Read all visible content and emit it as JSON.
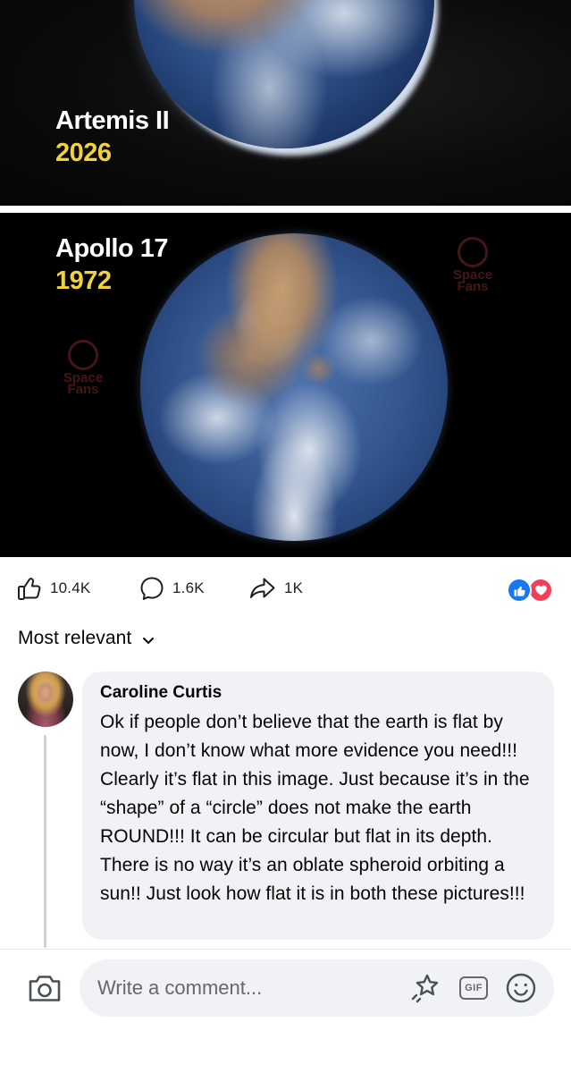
{
  "post": {
    "top_image": {
      "title": "Artemis II",
      "year": "2026"
    },
    "bottom_image": {
      "title": "Apollo 17",
      "year": "1972"
    },
    "watermark": {
      "line1": "Space",
      "line2": "Fans"
    }
  },
  "actions": {
    "likes": "10.4K",
    "comments": "1.6K",
    "shares": "1K"
  },
  "reaction_icons": [
    "like-icon",
    "love-icon"
  ],
  "colors": {
    "like_blue": "#1877f2",
    "love_red": "#f33e58",
    "caption_year_yellow": "#f2d13a",
    "bubble_bg": "#f0f2f5"
  },
  "sort": {
    "label": "Most relevant"
  },
  "comment": {
    "author": "Caroline Curtis",
    "text": "Ok if people don’t believe that the earth is flat by now, I don’t know what more evidence you need!!!  Clearly it’s flat in this image. Just because it’s in the “shape” of a “circle” does not make the earth ROUND!!! It can be circular but flat in its depth. There is no way it’s an oblate spheroid orbiting a sun!!  Just look how flat it is in both these pictures!!!"
  },
  "composer": {
    "placeholder": "Write a comment...",
    "gif_label": "GIF"
  }
}
